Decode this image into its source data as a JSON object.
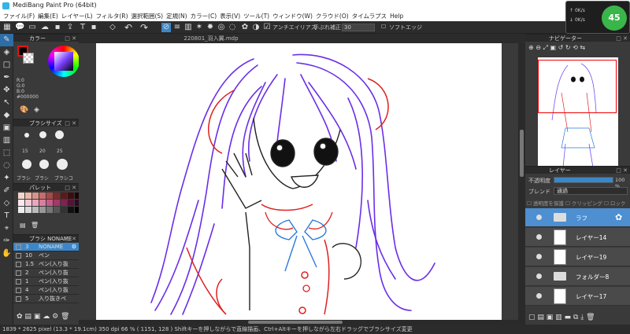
{
  "window": {
    "title": "MediBang Paint Pro (64bit)"
  },
  "menu": [
    "ファイル(F)",
    "編集(E)",
    "レイヤー(L)",
    "フィルタ(R)",
    "選択範囲(S)",
    "定規(N)",
    "カラー(C)",
    "表示(V)",
    "ツール(T)",
    "ウィンドウ(W)",
    "クラウド(O)",
    "タイムラプス",
    "Help"
  ],
  "perf": {
    "percent": "45",
    "up": "0K/s",
    "down": "0K/s"
  },
  "toolbar": {
    "antialias": "アンチエイリアス",
    "stabilizer": "手ぶれ補正",
    "stabilizer_value": "30",
    "soft_edge": "ソフトエッジ"
  },
  "color_panel": {
    "title": "カラー",
    "r": "R:0",
    "g": "G:0",
    "b": "B:0",
    "hex": "#000000",
    "primary": "#000000",
    "accent": "#3c87c9"
  },
  "brush_size_panel": {
    "title": "ブラシサイズ",
    "sizes": [
      "15",
      "20",
      "25"
    ],
    "brush_names": [
      "ブラシ",
      "ブラシ",
      "ブラシコ"
    ]
  },
  "palette_panel": {
    "title": "パレット"
  },
  "brush_panel": {
    "title": "ブラシ NONAME",
    "items": [
      {
        "num": "3",
        "name": "NONAME",
        "selected": true
      },
      {
        "num": "10",
        "name": "ペン"
      },
      {
        "num": "1.5",
        "name": "ペン(入り抜"
      },
      {
        "num": "2",
        "name": "ペン(入り抜"
      },
      {
        "num": "1",
        "name": "ペン(入り抜"
      },
      {
        "num": "4",
        "name": "ペン(入り抜"
      },
      {
        "num": "5",
        "name": "入り抜きペ"
      }
    ]
  },
  "canvas": {
    "tab_label": "220801_羽入翼.mdp"
  },
  "navigator": {
    "title": "ナビゲーター"
  },
  "layers_panel": {
    "title": "レイヤー",
    "opacity_label": "不透明度",
    "opacity_value": "100 %",
    "blend_label": "ブレンド",
    "blend_value": "通過",
    "protect_alpha": "透明度を保護",
    "clipping": "クリッピング",
    "lock": "ロック",
    "layers": [
      {
        "name": "ラフ",
        "type": "folder",
        "selected": true
      },
      {
        "name": "レイヤー14",
        "type": "layer"
      },
      {
        "name": "レイヤー19",
        "type": "layer"
      },
      {
        "name": "フォルダー8",
        "type": "folder"
      },
      {
        "name": "レイヤー17",
        "type": "layer"
      }
    ]
  },
  "status": {
    "text": "1839 * 2625 pixel  (13.3 * 19.1cm)  350 dpi  66 %  ( 1151, 128 )  Shiftキーを押しながらで直線描画、Ctrl+Altキーを押しながら左右ドラッグでブラシサイズ変更"
  }
}
